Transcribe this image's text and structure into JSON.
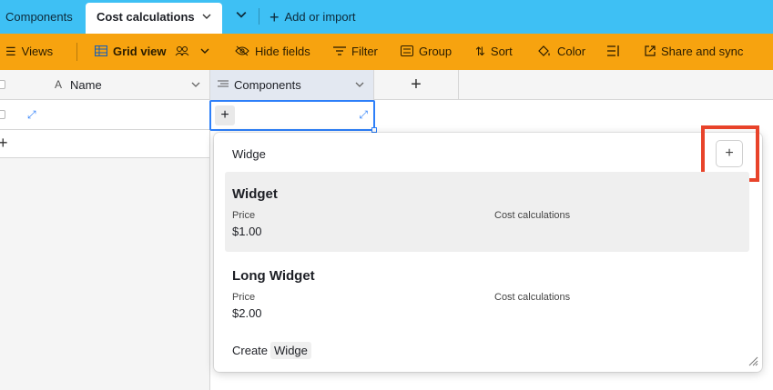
{
  "tabs": {
    "inactive_label": "Components",
    "active_label": "Cost calculations",
    "add_import_label": "Add or import"
  },
  "toolbar": {
    "views_label": "Views",
    "grid_view_label": "Grid view",
    "hide_fields_label": "Hide fields",
    "filter_label": "Filter",
    "group_label": "Group",
    "sort_label": "Sort",
    "color_label": "Color",
    "share_label": "Share and sync"
  },
  "grid": {
    "columns": [
      {
        "label": "Name"
      },
      {
        "label": "Components"
      }
    ]
  },
  "popup": {
    "search_text": "Widge",
    "records": [
      {
        "title": "Widget",
        "field1_label": "Price",
        "field1_value": "$1.00",
        "field2_label": "Cost calculations"
      },
      {
        "title": "Long Widget",
        "field1_label": "Price",
        "field1_value": "$2.00",
        "field2_label": "Cost calculations"
      }
    ],
    "create_label": "Create",
    "create_chip": "Widge"
  },
  "colors": {
    "tabbar": "#3ec0f4",
    "toolbar": "#f7a30f",
    "accent": "#2d7ff9",
    "highlight": "#e8432a"
  }
}
